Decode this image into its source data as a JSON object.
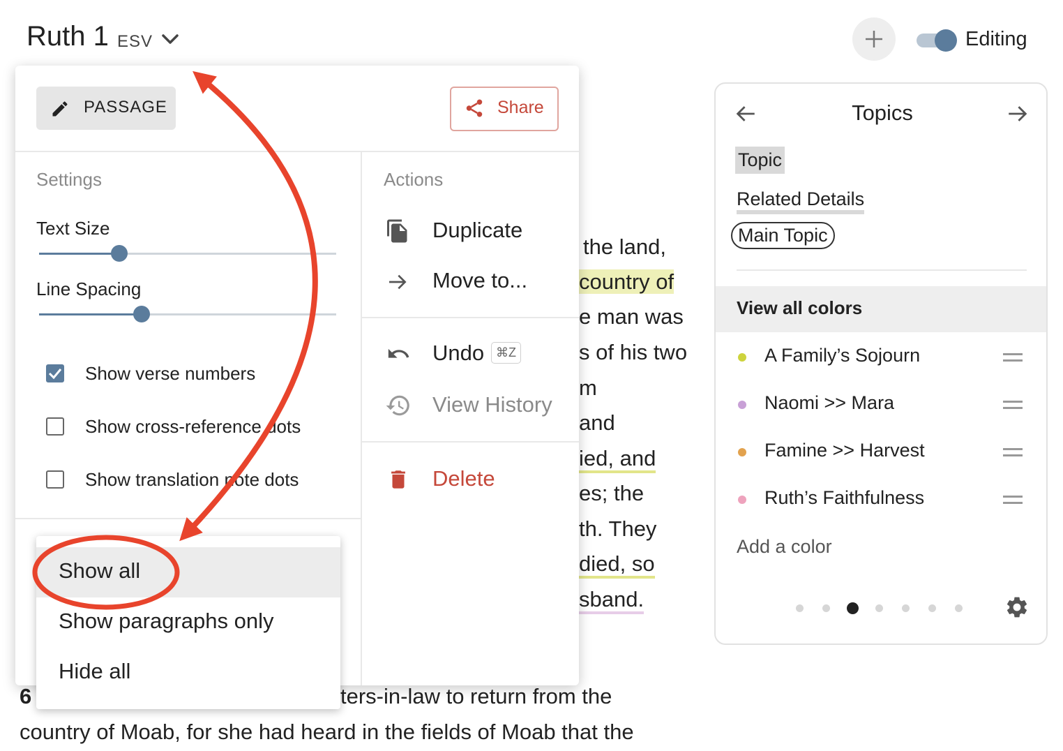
{
  "header": {
    "title": "Ruth 1",
    "version": "ESV",
    "editing_label": "Editing",
    "editing_on": true
  },
  "passage": {
    "fragments": [
      "the land,",
      "country of",
      "e man was",
      "s of his two",
      "m",
      "and",
      "ied, and",
      "es; the",
      "th. They",
      "died, so",
      "sband."
    ],
    "verse_number": "6",
    "line_a": "ters-in-law to return from the",
    "line_b": "country of Moab, for she had heard in the fields of Moab that the"
  },
  "menu": {
    "passage_button": "PASSAGE",
    "share_button": "Share",
    "settings": {
      "heading": "Settings",
      "text_size_label": "Text Size",
      "text_size_level": 0.27,
      "line_spacing_label": "Line Spacing",
      "line_spacing_level": 0.345,
      "checkboxes": [
        {
          "label": "Show verse numbers",
          "checked": true
        },
        {
          "label": "Show cross-reference dots",
          "checked": false
        },
        {
          "label": "Show translation note dots",
          "checked": false
        }
      ]
    },
    "actions": {
      "heading": "Actions",
      "duplicate": "Duplicate",
      "move_to": "Move to...",
      "undo": "Undo",
      "undo_shortcut": "⌘Z",
      "view_history": "View History",
      "delete": "Delete"
    }
  },
  "dropdown": {
    "options": [
      "Show all",
      "Show paragraphs only",
      "Hide all"
    ],
    "selected": "Show all"
  },
  "topics_panel": {
    "title": "Topics",
    "tags": [
      "Topic",
      "Related Details",
      "Main Topic"
    ],
    "view_all_colors": "View all colors",
    "colors": [
      {
        "name": "A Family’s Sojourn",
        "color": "#cdd33d"
      },
      {
        "name": "Naomi >> Mara",
        "color": "#c8a0d6"
      },
      {
        "name": "Famine >> Harvest",
        "color": "#e2a24e"
      },
      {
        "name": "Ruth’s Faithfulness",
        "color": "#eea3bd"
      }
    ],
    "add_color": "Add a color",
    "page_count": 7,
    "current_page": 3
  },
  "colors": {
    "accent": "#5b7c9c",
    "danger": "#c5483a",
    "arrow": "#e8442c"
  }
}
